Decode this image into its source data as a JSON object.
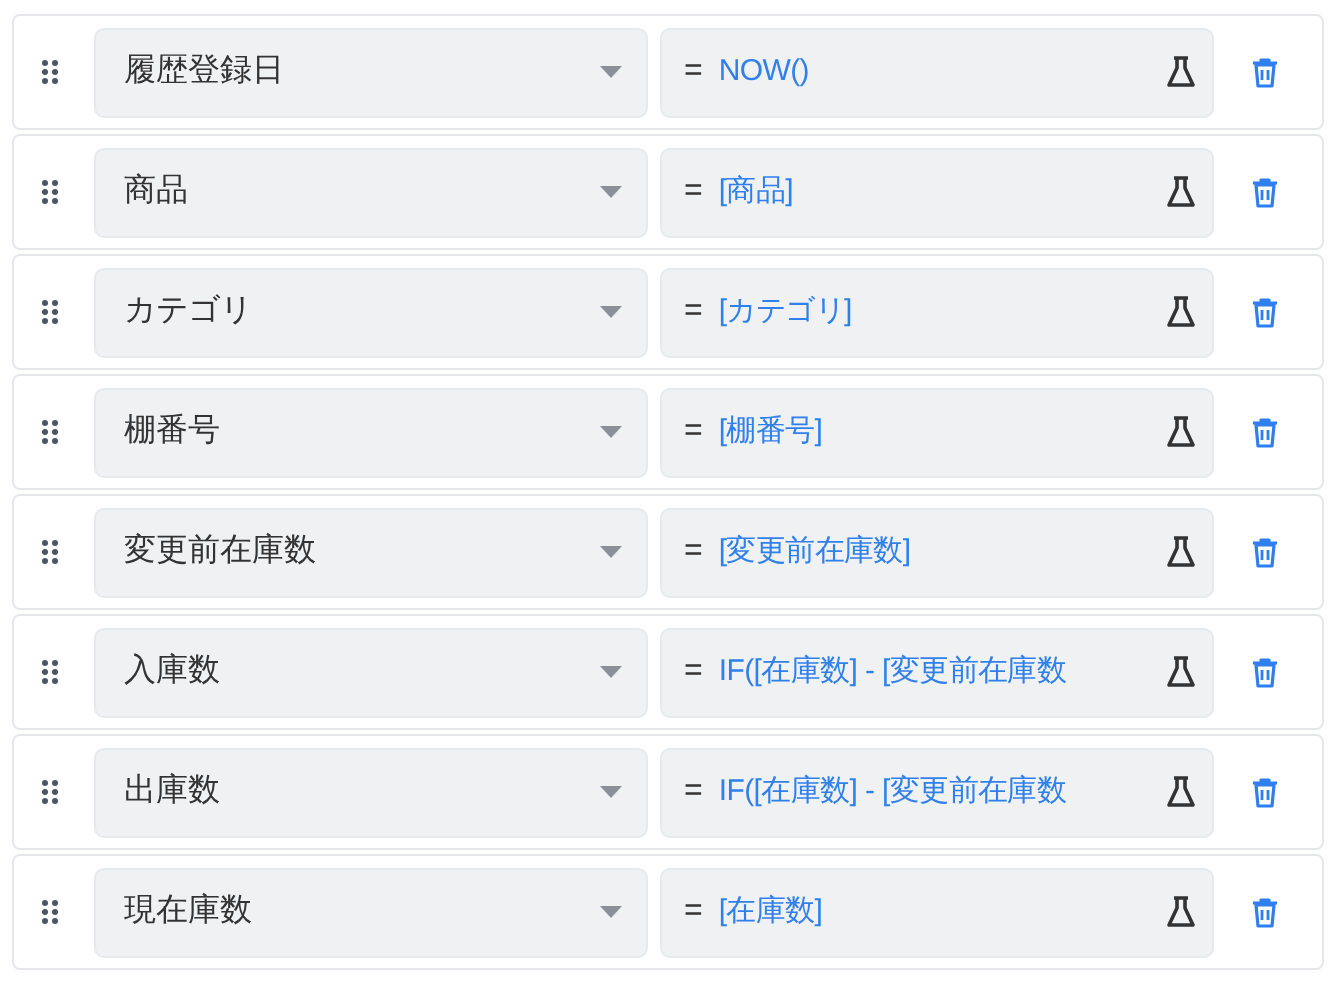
{
  "rows": [
    {
      "column": "履歴登録日",
      "equals": "=",
      "formula": "NOW()"
    },
    {
      "column": "商品",
      "equals": "=",
      "formula": "[商品]"
    },
    {
      "column": "カテゴリ",
      "equals": "=",
      "formula": "[カテゴリ]"
    },
    {
      "column": "棚番号",
      "equals": "=",
      "formula": "[棚番号]"
    },
    {
      "column": "変更前在庫数",
      "equals": "=",
      "formula": "[変更前在庫数]"
    },
    {
      "column": "入庫数",
      "equals": "=",
      "formula": "IF([在庫数] - [変更前在庫数"
    },
    {
      "column": "出庫数",
      "equals": "=",
      "formula": "IF([在庫数] - [変更前在庫数"
    },
    {
      "column": "現在庫数",
      "equals": "=",
      "formula": "[在庫数]"
    }
  ]
}
